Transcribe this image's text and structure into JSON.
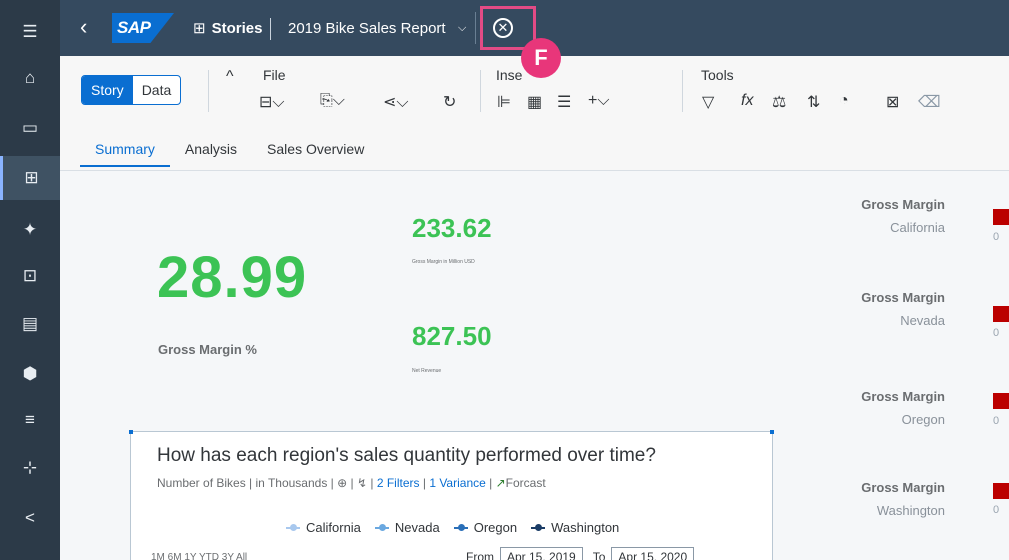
{
  "rail": {
    "items": [
      {
        "icon": "menu-icon",
        "glyph": "☰"
      },
      {
        "icon": "home-icon",
        "glyph": "⌂"
      },
      {
        "icon": "folder-icon",
        "glyph": "▭"
      },
      {
        "icon": "stories-icon",
        "glyph": "⊞",
        "active": true
      },
      {
        "icon": "analytics-icon",
        "glyph": "✦"
      },
      {
        "icon": "planning-icon",
        "glyph": "⊡"
      },
      {
        "icon": "datasets-icon",
        "glyph": "▤"
      },
      {
        "icon": "modeler-icon",
        "glyph": "⬢"
      },
      {
        "icon": "import-icon",
        "glyph": "≡"
      },
      {
        "icon": "transfer-icon",
        "glyph": "⊹"
      },
      {
        "icon": "share-icon",
        "glyph": "<"
      }
    ]
  },
  "header": {
    "back_glyph": "‹",
    "logo_text": "SAP",
    "stories_label": "Stories",
    "story_title": "2019 Bike Sales Report",
    "dropdown_glyph": "⌵",
    "close_glyph": "✕",
    "annotation_badge": "F"
  },
  "toolbar": {
    "segment": {
      "story": "Story",
      "data": "Data"
    },
    "collapse_glyph": "^",
    "file_label": "File",
    "insert_label": "Inse",
    "tools_label": "Tools",
    "file_icons": [
      "save-icon",
      "copy-icon",
      "share-icon",
      "refresh-icon"
    ],
    "insert_icons": [
      "bar-chart-icon",
      "table-icon",
      "filter-controls-icon",
      "add-icon"
    ],
    "tool_icons": [
      "filter-icon",
      "formula-icon",
      "compare-icon",
      "sort-icon",
      "smart-insights-icon",
      "lock-icon",
      "clear-icon"
    ],
    "formula_text": "fx"
  },
  "tabs": [
    {
      "label": "Summary",
      "active": true
    },
    {
      "label": "Analysis"
    },
    {
      "label": "Sales Overview"
    }
  ],
  "kpis": {
    "big_value": "28.99",
    "big_label": "Gross Margin %",
    "gm_value": "233.62",
    "gm_label": "Gross Margin in Million USD",
    "rev_value": "827.50",
    "rev_label": "Net Revenue"
  },
  "gross_margin_panels": [
    {
      "title": "Gross Margin",
      "region": "California",
      "zero": "0"
    },
    {
      "title": "Gross Margin",
      "region": "Nevada",
      "zero": "0"
    },
    {
      "title": "Gross Margin",
      "region": "Oregon",
      "zero": "0"
    },
    {
      "title": "Gross Margin",
      "region": "Washington",
      "zero": "0"
    }
  ],
  "chart_card": {
    "question": "How has each region's sales quantity performed over time?",
    "subtitle_start": "Number of Bikes | in Thousands | ",
    "filters_link": "2 Filters",
    "variance_link": "1 Variance",
    "forecast": "Forcast",
    "legend": [
      {
        "name": "California",
        "color": "#a8c8ee"
      },
      {
        "name": "Nevada",
        "color": "#6aa8e0"
      },
      {
        "name": "Oregon",
        "color": "#2a6fb8"
      },
      {
        "name": "Washington",
        "color": "#1a3c66"
      }
    ],
    "range_labels": "1M  6M  1Y  YTD  3Y  All",
    "from_label": "From",
    "from_date": "Apr 15, 2019",
    "to_label": "To",
    "to_date": "Apr 15, 2020"
  },
  "colors": {
    "shell": "#354a5f",
    "rail": "#2c3a48",
    "kpi_green": "#3cc355",
    "accent": "#0a6ed1",
    "negative": "#bb0000",
    "highlight": "#e34b85"
  }
}
